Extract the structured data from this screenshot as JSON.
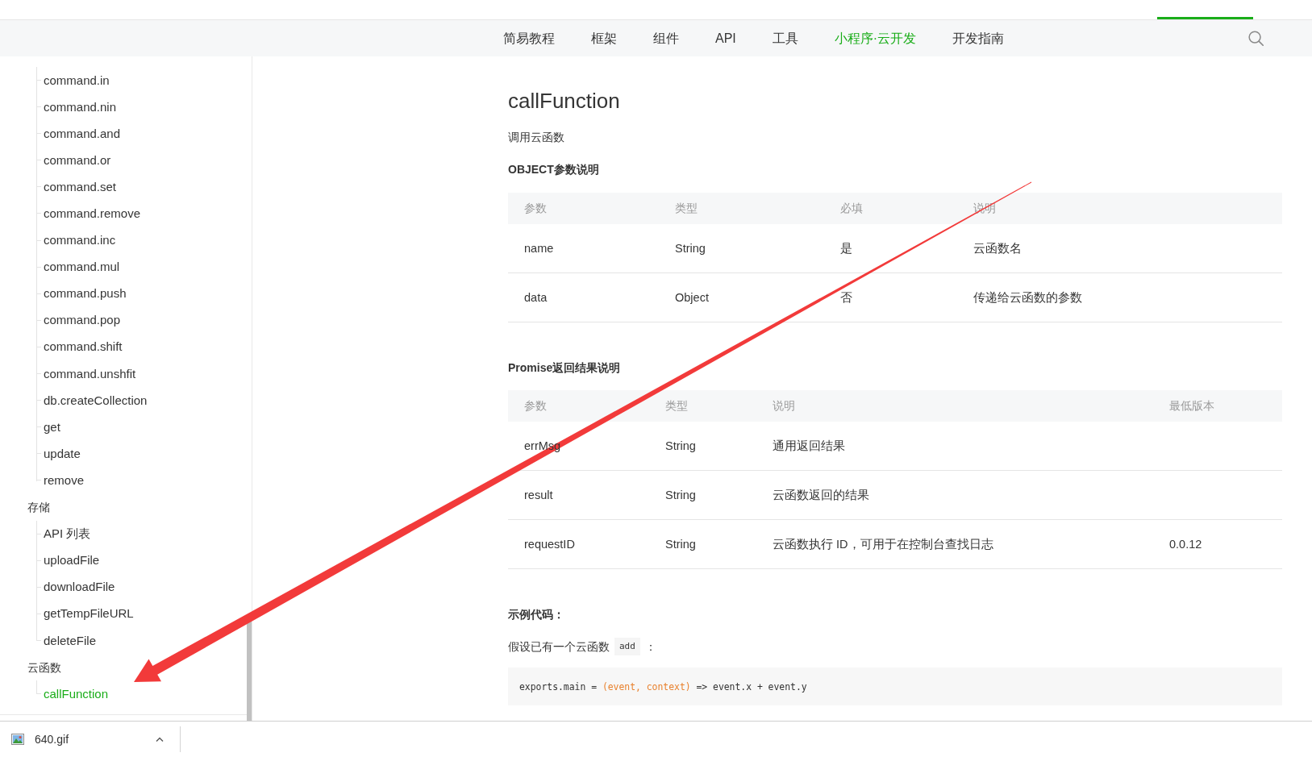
{
  "nav": {
    "items": [
      {
        "label": "简易教程",
        "selected": false
      },
      {
        "label": "框架",
        "selected": false
      },
      {
        "label": "组件",
        "selected": false
      },
      {
        "label": "API",
        "selected": false
      },
      {
        "label": "工具",
        "selected": false
      },
      {
        "label": "小程序·云开发",
        "selected": true
      },
      {
        "label": "开发指南",
        "selected": false
      }
    ]
  },
  "sidebar": {
    "sections": [
      {
        "items": [
          {
            "label": "command.in",
            "selected": false
          },
          {
            "label": "command.nin",
            "selected": false
          },
          {
            "label": "command.and",
            "selected": false
          },
          {
            "label": "command.or",
            "selected": false
          },
          {
            "label": "command.set",
            "selected": false
          },
          {
            "label": "command.remove",
            "selected": false
          },
          {
            "label": "command.inc",
            "selected": false
          },
          {
            "label": "command.mul",
            "selected": false
          },
          {
            "label": "command.push",
            "selected": false
          },
          {
            "label": "command.pop",
            "selected": false
          },
          {
            "label": "command.shift",
            "selected": false
          },
          {
            "label": "command.unshfit",
            "selected": false
          },
          {
            "label": "db.createCollection",
            "selected": false
          },
          {
            "label": "get",
            "selected": false
          },
          {
            "label": "update",
            "selected": false
          },
          {
            "label": "remove",
            "selected": false
          }
        ]
      },
      {
        "title": "存储",
        "items": [
          {
            "label": "API 列表",
            "selected": false
          },
          {
            "label": "uploadFile",
            "selected": false
          },
          {
            "label": "downloadFile",
            "selected": false
          },
          {
            "label": "getTempFileURL",
            "selected": false
          },
          {
            "label": "deleteFile",
            "selected": false
          }
        ]
      },
      {
        "title": "云函数",
        "items": [
          {
            "label": "callFunction",
            "selected": true
          }
        ]
      }
    ]
  },
  "content": {
    "title": "callFunction",
    "description": "调用云函数",
    "tables": [
      {
        "heading": "OBJECT参数说明",
        "columns": [
          "参数",
          "类型",
          "必填",
          "说明"
        ],
        "rows": [
          {
            "cells": [
              "name",
              "String",
              "是",
              "云函数名"
            ]
          },
          {
            "cells": [
              "data",
              "Object",
              "否",
              "传递给云函数的参数"
            ]
          }
        ]
      },
      {
        "heading": "Promise返回结果说明",
        "columns": [
          "参数",
          "类型",
          "说明",
          "最低版本"
        ],
        "rows": [
          {
            "cells": [
              "errMsg",
              "String",
              "通用返回结果"
            ]
          },
          {
            "cells": [
              "result",
              "String",
              "云函数返回的结果"
            ]
          },
          {
            "cells": [
              "requestID",
              "String",
              "云函数执行 ID，可用于在控制台查找日志",
              "0.0.12"
            ]
          }
        ]
      }
    ],
    "example": {
      "heading": "示例代码：",
      "text": "假设已有一个云函数",
      "inline_code": "add",
      "text_after": "：",
      "code": [
        {
          "kind": "plain",
          "text": "exports.main = "
        },
        {
          "kind": "param",
          "text": "(event, context)"
        },
        {
          "kind": "plain",
          "text": " => event.x + event.y"
        }
      ]
    }
  },
  "download_bar": {
    "items": [
      {
        "file_name": "640.gif"
      }
    ]
  }
}
